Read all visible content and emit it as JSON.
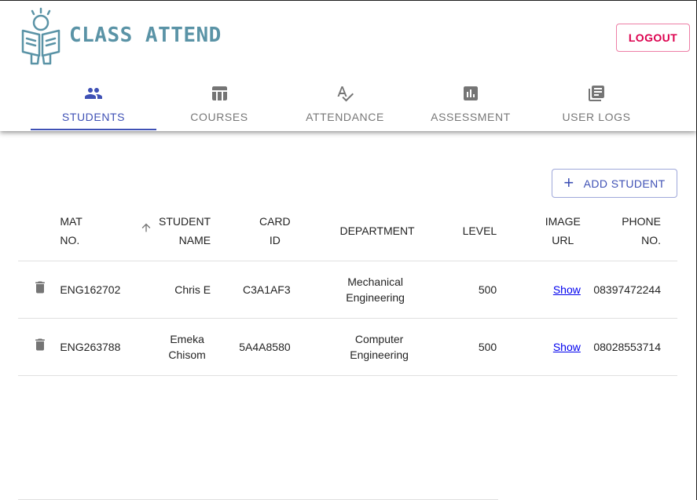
{
  "brand": {
    "name": "CLASS ATTEND",
    "color": "#5a93a6"
  },
  "header": {
    "logout_label": "LOGOUT"
  },
  "tabs": [
    {
      "label": "STUDENTS",
      "icon": "people-icon",
      "active": true
    },
    {
      "label": "COURSES",
      "icon": "table-icon",
      "active": false
    },
    {
      "label": "ATTENDANCE",
      "icon": "spellcheck-icon",
      "active": false
    },
    {
      "label": "ASSESSMENT",
      "icon": "assessment-icon",
      "active": false
    },
    {
      "label": "USER LOGS",
      "icon": "library-books-icon",
      "active": false
    }
  ],
  "toolbar": {
    "add_label": "ADD STUDENT"
  },
  "table": {
    "columns": {
      "mat_1": "MAT",
      "mat_2": "NO.",
      "name_1": "STUDENT",
      "name_2": "NAME",
      "card_1": "CARD",
      "card_2": "ID",
      "dept": "DEPARTMENT",
      "level": "LEVEL",
      "image_1": "IMAGE",
      "image_2": "URL",
      "phone_1": "PHONE",
      "phone_2": "NO."
    },
    "rows": [
      {
        "mat": "ENG162702",
        "name": "Chris E",
        "card": "C3A1AF3",
        "dept": "Mechanical Engineering",
        "level": "500",
        "image": "Show",
        "phone": "08397472244"
      },
      {
        "mat": "ENG263788",
        "name": "Emeka Chisom",
        "card": "5A4A8580",
        "dept": "Computer Engineering",
        "level": "500",
        "image": "Show",
        "phone": "08028553714"
      }
    ]
  },
  "colors": {
    "primary": "#3f51b5",
    "secondary": "#dc004e"
  }
}
